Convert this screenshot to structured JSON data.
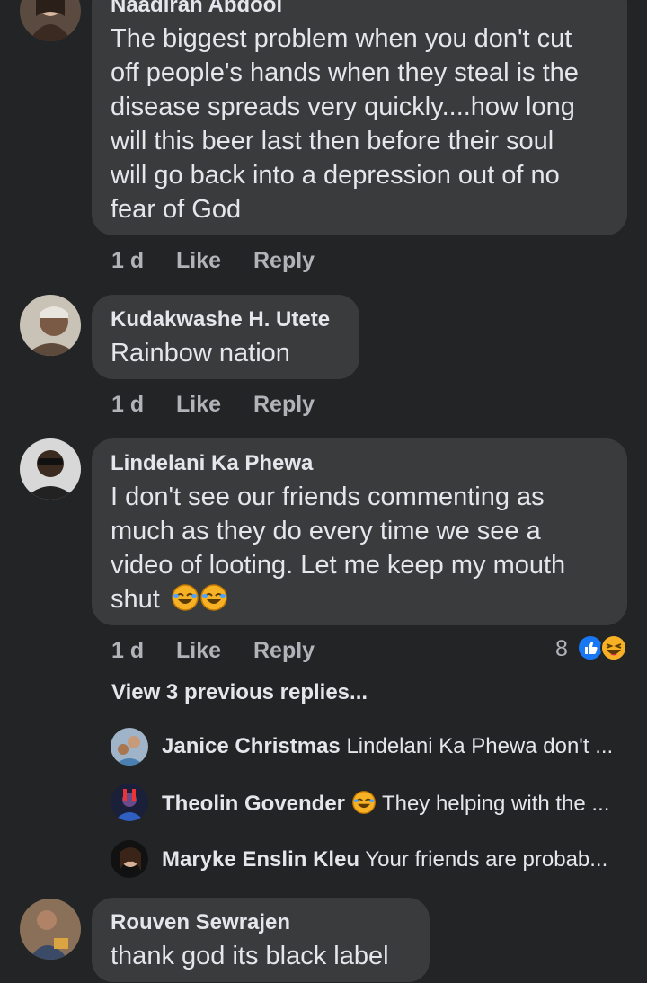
{
  "comments": [
    {
      "author": "Naadiran Abdool",
      "text_lines": [
        "The biggest problem when you don't cut",
        "off people's hands when they steal is the",
        "disease spreads very quickly....how long",
        "will this beer last then before their soul",
        "will go back into a depression out of no",
        "fear of God"
      ],
      "time": "1 d",
      "like": "Like",
      "reply": "Reply"
    },
    {
      "author": "Kudakwashe H. Utete",
      "text_lines": [
        "Rainbow nation"
      ],
      "time": "1 d",
      "like": "Like",
      "reply": "Reply"
    },
    {
      "author": "Lindelani Ka Phewa",
      "text_lines": [
        "I don't see our friends commenting as",
        "much as they do every time we see a",
        "video of looting. Let me keep my mouth",
        "shut"
      ],
      "time": "1 d",
      "like": "Like",
      "reply": "Reply",
      "reaction_count": "8"
    },
    {
      "author": "Rouven Sewrajen",
      "text_lines": [
        "thank god its black label"
      ]
    }
  ],
  "view_previous": "View 3 previous replies...",
  "replies": [
    {
      "author": "Janice Christmas",
      "text": "Lindelani Ka Phewa don't ..."
    },
    {
      "author": "Theolin Govender",
      "text": "They helping with the ..."
    },
    {
      "author": "Maryke Enslin Kleu",
      "text": "Your friends are probab..."
    }
  ],
  "colors": {
    "background": "#232426",
    "bubble": "#3a3b3d",
    "text": "#e4e6eb",
    "muted": "#b0b3b8",
    "like_blue": "#1877f2",
    "haha_yellow": "#f7b125"
  }
}
